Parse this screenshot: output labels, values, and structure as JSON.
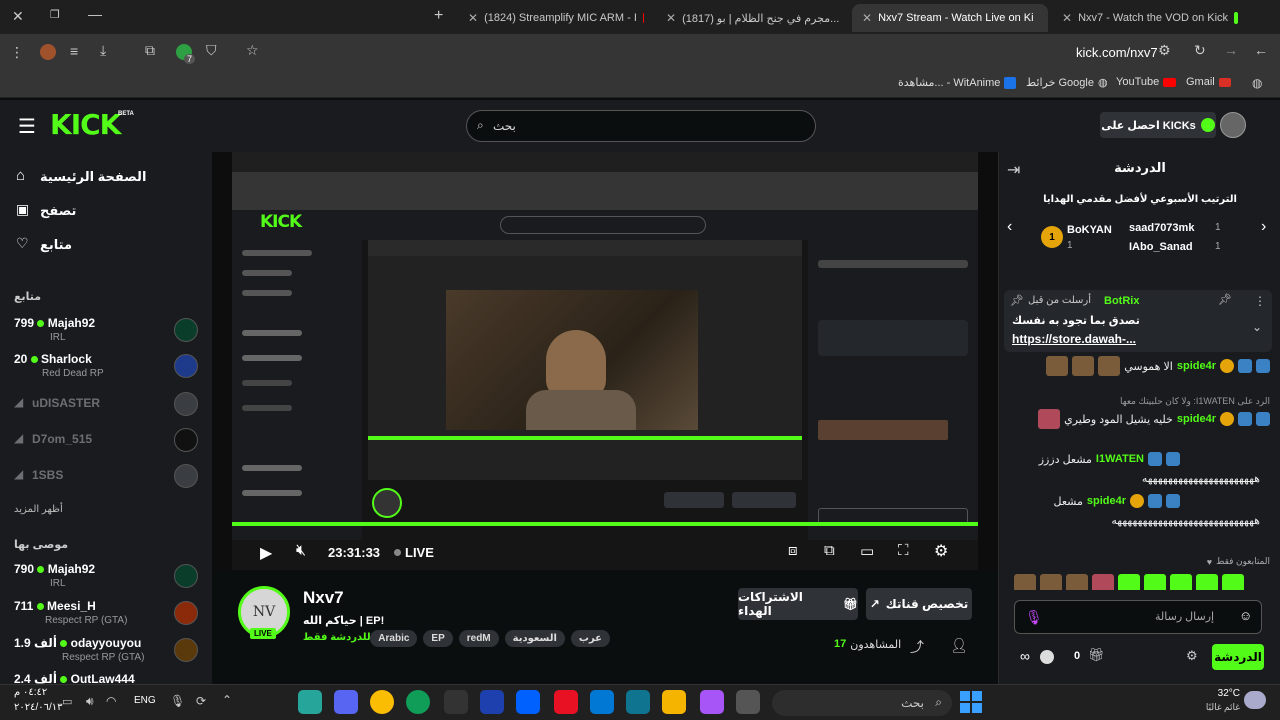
{
  "browser": {
    "tabs": [
      {
        "label": "Nxv7 - Watch the VOD on Kick",
        "icon": "kick-icon"
      },
      {
        "label": "Nxv7 Stream - Watch Live on Ki",
        "icon": "kick-icon",
        "active": true
      },
      {
        "label": "(1817) مجرم في جنح الظلام | بو...",
        "icon": "youtube-icon"
      },
      {
        "label": "(1824) Streamplify MIC ARM - I",
        "icon": "youtube-icon"
      }
    ],
    "url": "kick.com/nxv7",
    "extension_badge": "7",
    "bookmarks": [
      {
        "label": "Gmail",
        "icon": "gmail-icon"
      },
      {
        "label": "YouTube",
        "icon": "youtube-icon"
      },
      {
        "label": "خرائط Google",
        "icon": "globe-icon"
      },
      {
        "label": "مشاهدة... - WitAnime",
        "icon": "witanime-icon"
      }
    ]
  },
  "kick": {
    "logo": "KICK",
    "logo_beta": "BETA",
    "search_placeholder": "بحث",
    "get_kicks": "احصل على KICKs"
  },
  "sidebar": {
    "nav": [
      {
        "label": "الصفحة الرئيسية",
        "icon": "home-icon"
      },
      {
        "label": "تصفح",
        "icon": "browse-icon"
      },
      {
        "label": "متابع",
        "icon": "heart-icon"
      }
    ],
    "following_title": "متابع",
    "following": [
      {
        "name": "Majah92",
        "viewers": "799",
        "category": "IRL",
        "live": true
      },
      {
        "name": "Sharlock",
        "viewers": "20",
        "category": "Red Dead RP",
        "live": true
      },
      {
        "name": "uDISASTER",
        "viewers": "",
        "category": "",
        "live": false
      },
      {
        "name": "D7om_515",
        "viewers": "",
        "category": "",
        "live": false
      },
      {
        "name": "1SBS",
        "viewers": "",
        "category": "",
        "live": false
      }
    ],
    "show_more": "أظهر المزيد",
    "recommended_title": "موصى بها",
    "recommended": [
      {
        "name": "Majah92",
        "viewers": "790",
        "category": "IRL"
      },
      {
        "name": "Meesi_H",
        "viewers": "711",
        "category": "Respect RP (GTA)"
      },
      {
        "name": "odayyouyou",
        "viewers": "1.9 ألف",
        "category": "Respect RP (GTA)"
      },
      {
        "name": "OutLaw444",
        "viewers": "2.4 ألف",
        "category": ""
      }
    ]
  },
  "player": {
    "time": "23:31:33",
    "live_label": "LIVE"
  },
  "stream": {
    "channel": "Nxv7",
    "title": "حياكم الله | EP!",
    "subtitle": "مخصصة للدردشة فقط",
    "live_badge": "LIVE",
    "tags": [
      "عرب",
      "السعودية",
      "redM",
      "EP",
      "Arabic"
    ],
    "viewers_label": "المشاهدون",
    "viewers": "17",
    "customize_button": "تخصيص قناتك",
    "gift_subs_button": "الاشتراكات الهداء"
  },
  "chat": {
    "title": "الدردشة",
    "leaderboard_title": "الترتيب الأسبوعي لأفضل مقدمي الهدايا",
    "leaders": [
      {
        "name": "BoKYAN",
        "rank": "1",
        "count": "1"
      },
      {
        "name": "saad7073mk",
        "rank": "1",
        "count": "1"
      },
      {
        "name": "IAbo_Sanad",
        "rank": "1",
        "count": "1"
      }
    ],
    "pinned": {
      "by": "أرسلت من قبل",
      "user": "BotRix",
      "text": "تصدق بما تجود به نفسك",
      "link": "https://store.dawah-..."
    },
    "messages": [
      {
        "user": "spide4r",
        "text": "الا هموسي",
        "badges": 1
      },
      {
        "reply": "الرد على I1WATEN: ولا كان حلبيتك معها",
        "user": "spide4r",
        "text": "خليه يشيل المود وطيري"
      },
      {
        "user": "I1WATEN",
        "text": "مشعل دززز"
      },
      {
        "user": "",
        "text": "ههههههههههههههههههههههه"
      },
      {
        "user": "spide4r",
        "text": "مشعل"
      },
      {
        "user": "",
        "text": "ههههههههههههههههههههههههههههه"
      }
    ],
    "supporters_label": "المتابعون فقط",
    "input_placeholder": "إرسال رسالة",
    "send_button": "الدردشة",
    "kicks_count": "0"
  },
  "taskbar": {
    "search": "بحث",
    "time": "٠٤:٤٢ م",
    "date": "٢٠٢٤/٠٦/١٣",
    "lang": "ENG",
    "weather_temp": "32°C",
    "weather_desc": "غائم غالبًا"
  }
}
